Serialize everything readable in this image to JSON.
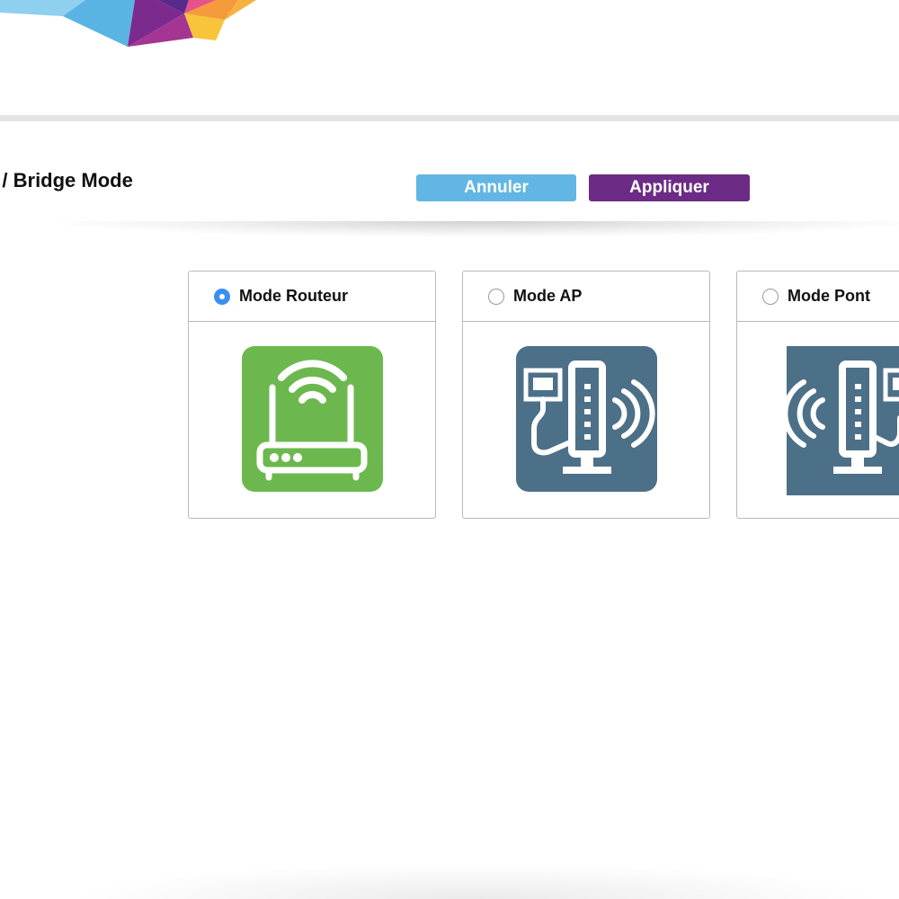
{
  "header": {
    "title": "P / Bridge Mode",
    "cancel_label": "Annuler",
    "apply_label": "Appliquer"
  },
  "modes": [
    {
      "label": "Mode Routeur",
      "selected": true,
      "icon": "router-icon"
    },
    {
      "label": "Mode AP",
      "selected": false,
      "icon": "access-point-icon"
    },
    {
      "label": "Mode Pont",
      "selected": false,
      "icon": "bridge-icon"
    }
  ],
  "colors": {
    "cancel": "#62b6e4",
    "apply": "#6c2b85",
    "radio_selected": "#3b8ff0",
    "router_tile": "#6cb84e",
    "ap_tile": "#4d7089",
    "bridge_tile": "#4d7089"
  }
}
